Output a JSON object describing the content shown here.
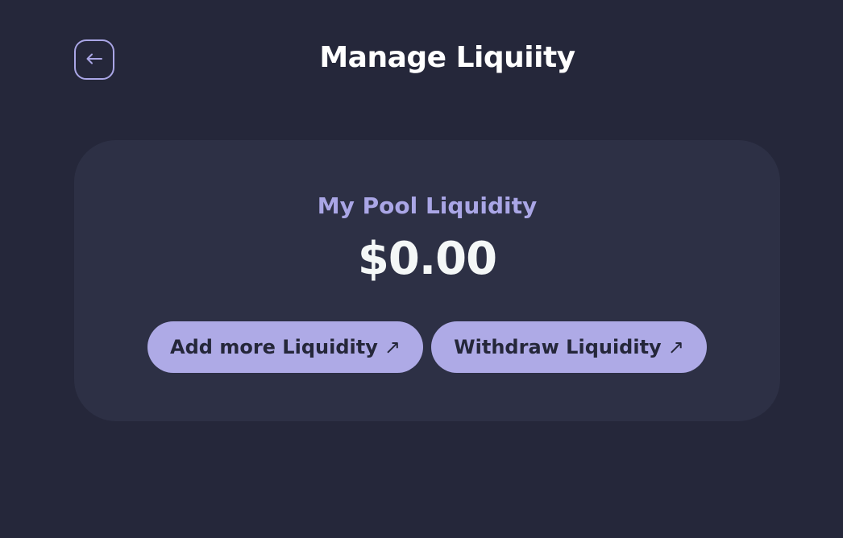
{
  "header": {
    "back_icon": "arrow-left-icon",
    "title": "Manage Liquiity"
  },
  "pool_card": {
    "label": "My Pool Liquidity",
    "value": "$0.00",
    "buttons": [
      {
        "label": "Add more Liquidity",
        "icon": "arrow-up-right-icon",
        "icon_glyph": "↗"
      },
      {
        "label": "Withdraw Liquidity",
        "icon": "arrow-up-right-icon",
        "icon_glyph": "↗"
      }
    ]
  },
  "colors": {
    "background": "#25273a",
    "card": "#2d3045",
    "accent": "#aeaae6",
    "text_primary": "#ffffff"
  }
}
